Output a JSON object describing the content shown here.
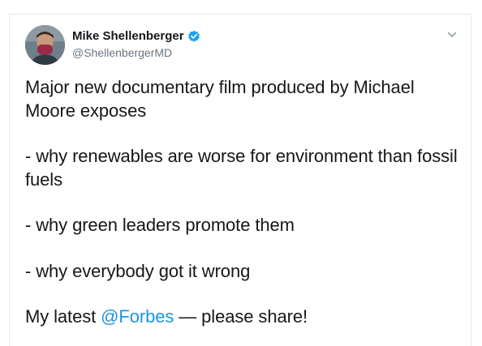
{
  "tweet": {
    "author_name": "Mike Shellenberger",
    "author_handle": "@ShellenbergerMD",
    "verified": true,
    "icons": {
      "verified": "verified-badge-icon",
      "menu": "chevron-down-icon",
      "avatar": "profile-avatar"
    },
    "colors": {
      "link": "#1b95e0",
      "verified": "#1da1f2",
      "handle": "#657786",
      "text": "#14171a"
    },
    "body": {
      "line1": "Major new documentary film produced by Michael Moore exposes",
      "line2": "- why renewables are worse for environment than fossil fuels",
      "line3": "- why green leaders promote them",
      "line4": "- why everybody got it wrong",
      "line5_prefix": "My latest ",
      "line5_mention": "@Forbes",
      "line5_suffix": " — please share!"
    }
  }
}
